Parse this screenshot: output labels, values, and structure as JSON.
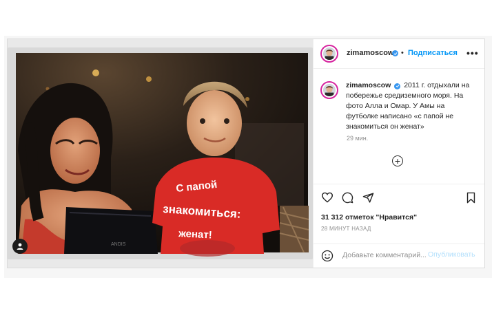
{
  "post": {
    "username": "zimamoscow",
    "separator": "•",
    "follow_label": "Подписаться",
    "more_label": "•••",
    "caption_user": "zimamoscow",
    "caption_text": "2011 г. отдыхали на побережье средиземного моря. На фото Алла и Омар. У Амы на футболке написано «с папой не знакомиться он женат»",
    "caption_time": "29 мин.",
    "likes": "31 312 отметок \"Нравится\"",
    "posted_ago": "28 МИНУТ НАЗАД",
    "comment_placeholder": "Добавьте комментарий...",
    "publish_label": "Опубликовать"
  },
  "photo": {
    "shirt_line1": "С папой",
    "shirt_line2": "знакомиться:",
    "shirt_line3": "женат!",
    "laptop_brand": "ANDIS"
  },
  "colors": {
    "accent": "#0095f6",
    "publish_disabled": "#b2dffc",
    "shirt": "#d92b26",
    "border": "#dbdbdb"
  },
  "icons": {
    "avatar_ring": "story-ring-icon",
    "verified": "verified-badge-icon",
    "user_tag": "user-tag-icon",
    "add": "plus-circle-icon",
    "like": "heart-icon",
    "comment": "comment-icon",
    "share": "share-icon",
    "save": "bookmark-icon",
    "emoji": "emoji-icon"
  }
}
